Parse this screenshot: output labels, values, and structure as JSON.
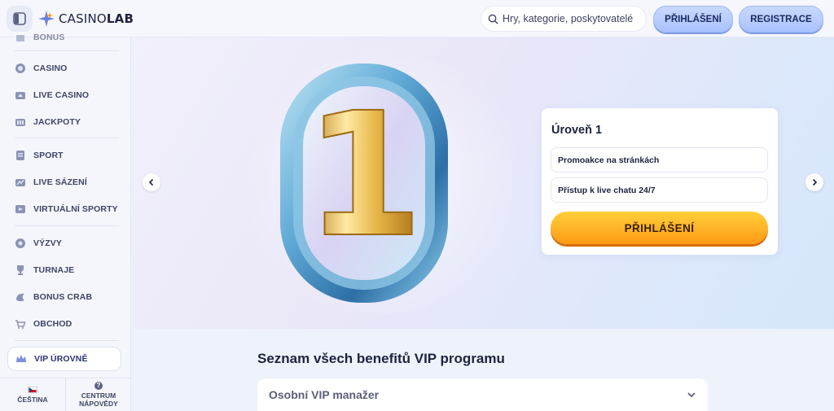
{
  "header": {
    "logo_text_light": "CASINO",
    "logo_text_bold": "LAB",
    "search_placeholder": "Hry, kategorie, poskytovatelé",
    "login_label": "PŘIHLÁŠENÍ",
    "register_label": "REGISTRACE"
  },
  "sidebar": {
    "partial_item": "BONUS",
    "items": [
      {
        "label": "CASINO",
        "icon": "casino-chip-icon"
      },
      {
        "label": "LIVE CASINO",
        "icon": "live-casino-icon"
      },
      {
        "label": "JACKPOTY",
        "icon": "jackpot-icon"
      },
      {
        "label": "SPORT",
        "icon": "sport-icon"
      },
      {
        "label": "LIVE SÁZENÍ",
        "icon": "live-betting-icon"
      },
      {
        "label": "VIRTUÁLNÍ SPORTY",
        "icon": "virtual-sports-icon"
      },
      {
        "label": "VÝZVY",
        "icon": "challenges-icon"
      },
      {
        "label": "TURNAJE",
        "icon": "trophy-icon"
      },
      {
        "label": "BONUS CRAB",
        "icon": "bonus-crab-icon"
      },
      {
        "label": "OBCHOD",
        "icon": "shop-icon"
      },
      {
        "label": "VIP ÚROVNĚ",
        "icon": "vip-crown-icon"
      }
    ],
    "language_label": "ČEŠTINA",
    "help_label_line1": "CENTRUM",
    "help_label_line2": "NÁPOVĚDY",
    "help_glyph": "?"
  },
  "hero": {
    "level_number": "1",
    "level_title": "Úroveň 1",
    "benefits": [
      "Promoakce na stránkách",
      "Přístup k live chatu 24/7"
    ],
    "cta_label": "PŘIHLÁŠENÍ"
  },
  "content": {
    "section_title": "Seznam všech benefitů VIP programu",
    "accordion_first": "Osobní VIP manažer"
  },
  "colors": {
    "accent_blue": "#a9c2ff",
    "cta_orange": "#ff9a14",
    "text_dark": "#1d2340"
  }
}
